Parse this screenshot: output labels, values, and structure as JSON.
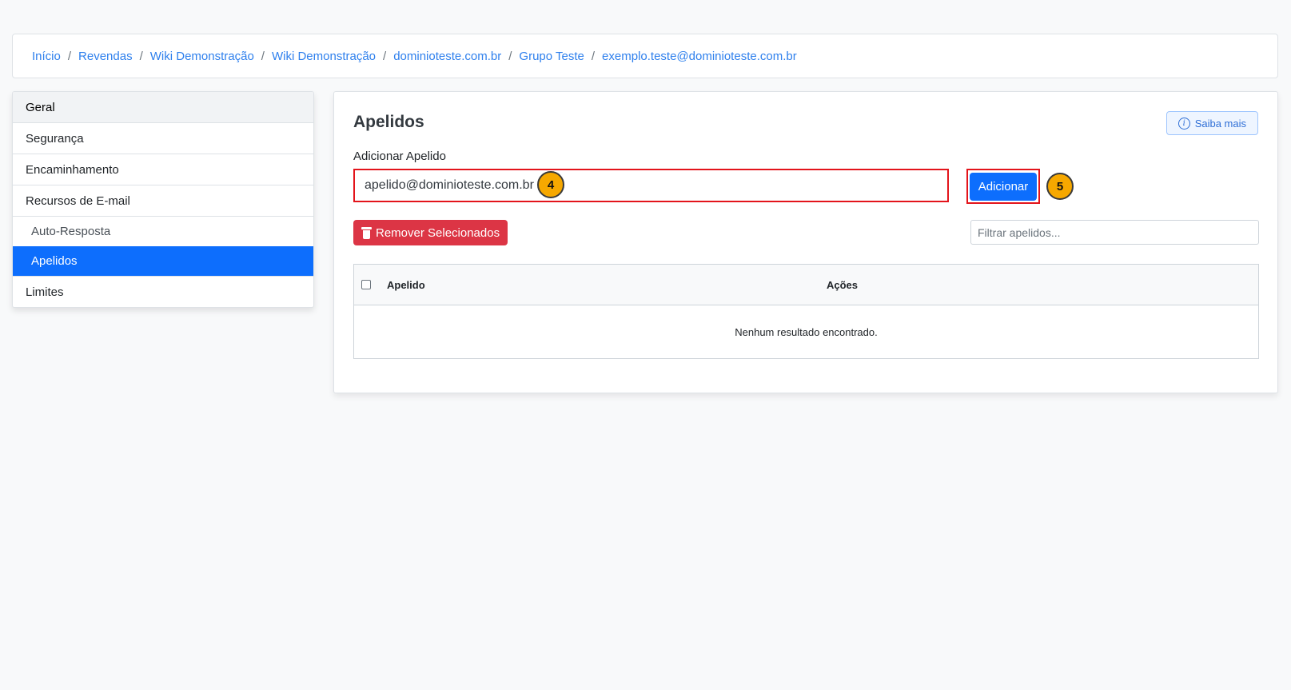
{
  "breadcrumb": {
    "items": [
      "Início",
      "Revendas",
      "Wiki Demonstração",
      "Wiki Demonstração",
      "dominioteste.com.br",
      "Grupo Teste",
      "exemplo.teste@dominioteste.com.br"
    ],
    "separator": "/"
  },
  "sidebar": {
    "items": [
      {
        "label": "Geral"
      },
      {
        "label": "Segurança"
      },
      {
        "label": "Encaminhamento"
      },
      {
        "label": "Recursos de E-mail"
      },
      {
        "label": "Auto-Resposta"
      },
      {
        "label": "Apelidos"
      },
      {
        "label": "Limites"
      }
    ]
  },
  "main": {
    "title": "Apelidos",
    "learn_more": "Saiba mais",
    "field_label": "Adicionar Apelido",
    "alias_value": "apelido@dominioteste.com.br",
    "add_button": "Adicionar",
    "remove_button": "Remover Selecionados",
    "filter_placeholder": "Filtrar apelidos...",
    "table": {
      "col_alias": "Apelido",
      "col_actions": "Ações",
      "empty": "Nenhum resultado encontrado."
    }
  },
  "markers": {
    "step_input": "4",
    "step_add": "5"
  },
  "colors": {
    "primary": "#0d6efd",
    "danger": "#dc3545",
    "highlight": "#e3141b",
    "marker": "#f6a800"
  }
}
